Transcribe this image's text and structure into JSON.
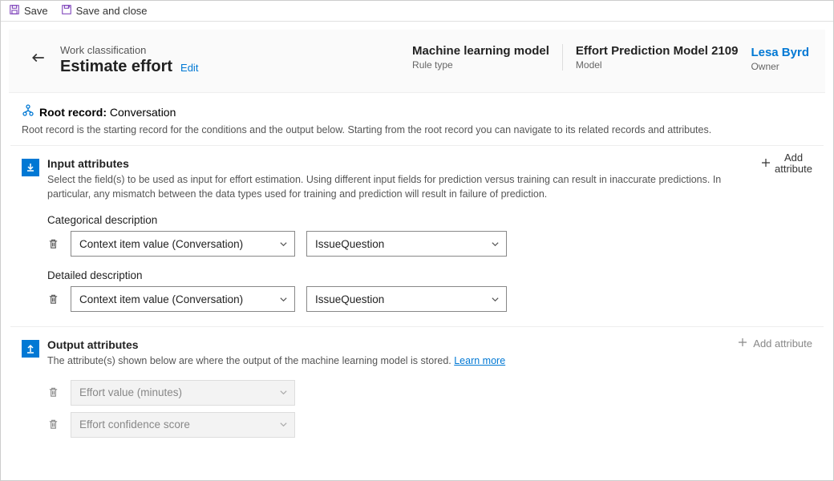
{
  "toolbar": {
    "save": "Save",
    "save_close": "Save and close"
  },
  "header": {
    "breadcrumb": "Work classification",
    "title": "Estimate effort",
    "edit": "Edit",
    "meta": [
      {
        "value": "Machine learning model",
        "label": "Rule type"
      },
      {
        "value": "Effort Prediction Model 2109",
        "label": "Model"
      }
    ],
    "owner": {
      "name": "Lesa Byrd",
      "label": "Owner"
    }
  },
  "root_record": {
    "label": "Root record:",
    "value": "Conversation",
    "desc": "Root record is the starting record for the conditions and the output below. Starting from the root record you can navigate to its related records and attributes."
  },
  "input_section": {
    "title": "Input attributes",
    "desc": "Select the field(s) to be used as input for effort estimation. Using different input fields for prediction versus training can result in inaccurate predictions. In particular, any mismatch between the data types used for training and prediction will result in failure of prediction.",
    "add_label_1": "Add",
    "add_label_2": "attribute",
    "rows": [
      {
        "label": "Categorical description",
        "field": "Context item value (Conversation)",
        "value": "IssueQuestion"
      },
      {
        "label": "Detailed description",
        "field": "Context item value (Conversation)",
        "value": "IssueQuestion"
      }
    ]
  },
  "output_section": {
    "title": "Output attributes",
    "desc_pre": "The attribute(s) shown below are where the output of the machine learning model is stored.  ",
    "learn_more": "Learn more",
    "add_label": "Add attribute",
    "rows": [
      {
        "value": "Effort value (minutes)"
      },
      {
        "value": "Effort confidence score"
      }
    ]
  }
}
